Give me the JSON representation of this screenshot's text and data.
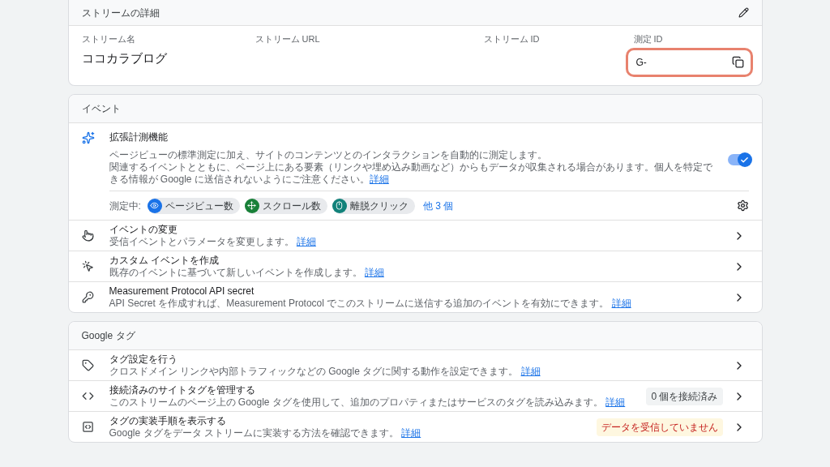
{
  "stream_details": {
    "title": "ストリームの詳細",
    "fields": [
      {
        "label": "ストリーム名",
        "value": "ココカラブログ"
      },
      {
        "label": "ストリーム URL"
      },
      {
        "label": "ストリーム ID"
      },
      {
        "label": "測定 ID",
        "value": "G-",
        "highlighted": true
      }
    ]
  },
  "events": {
    "title": "イベント",
    "enhanced_measurement": {
      "title": "拡張計測機能",
      "description": "ページビューの標準測定に加え、サイトのコンテンツとのインタラクションを自動的に測定します。",
      "note": "関連するイベントとともに、ページ上にある要素（リンクや埋め込み動画など）からもデータが収集される場合があります。個人を特定できる情報が Google に送信されないようにご注意ください。",
      "link": "詳細",
      "on": true,
      "measuring_label": "測定中:",
      "chips": [
        {
          "label": "ページビュー数",
          "kind": "eye",
          "color": "#1a73e8"
        },
        {
          "label": "スクロール数",
          "kind": "scroll",
          "color": "#188038"
        },
        {
          "label": "離脱クリック",
          "kind": "mouse",
          "color": "#12827a"
        }
      ],
      "more": "他 3 個"
    },
    "rows": [
      {
        "kind": "hand",
        "title": "イベントの変更",
        "description": "受信イベントとパラメータを変更します。",
        "link": "詳細"
      },
      {
        "kind": "click",
        "title": "カスタム イベントを作成",
        "description": "既存のイベントに基づいて新しいイベントを作成します。",
        "link": "詳細"
      },
      {
        "kind": "key",
        "title": "Measurement Protocol API secret",
        "description": "API Secret を作成すれば、Measurement Protocol でこのストリームに送信する追加のイベントを有効にできます。",
        "link": "詳細"
      }
    ]
  },
  "google_tag": {
    "title": "Google タグ",
    "rows": [
      {
        "kind": "tag",
        "title": "タグ設定を行う",
        "description": "クロスドメイン リンクや内部トラフィックなどの Google タグに関する動作を設定できます。",
        "link": "詳細"
      },
      {
        "kind": "code",
        "title": "接続済みのサイトタグを管理する",
        "description": "このストリームのページ上の Google タグを使用して、追加のプロパティまたはサービスのタグを読み込みます。",
        "link": "詳細",
        "badge": {
          "label": "0 個を接続済み",
          "kind": "neutral"
        }
      },
      {
        "kind": "install",
        "title": "タグの実装手順を表示する",
        "description": "Google タグをデータ ストリームに実装する方法を確認できます。",
        "link": "詳細",
        "badge": {
          "label": "データを受信していません",
          "kind": "warning"
        }
      }
    ]
  }
}
